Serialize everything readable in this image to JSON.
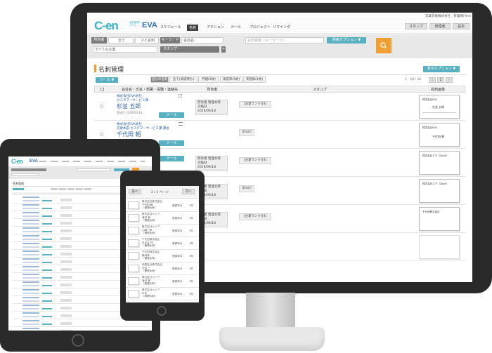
{
  "company": {
    "name": "営業支援株式会社",
    "user": "管理者(Yev)"
  },
  "app": {
    "logo_main": "C-en",
    "logo_sub": "名刺管理システム",
    "logo_eva": "EVA"
  },
  "nav": [
    "スケジュール",
    "名刺",
    "アクション",
    "メール",
    "プロジェクト",
    "リマインダ"
  ],
  "header_buttons": {
    "stamp": "スタンプ",
    "admin": "管理者",
    "settings": "設定"
  },
  "filters": {
    "owner_label": "所有者",
    "owner_value": "全て",
    "my_label": "マイ名刺",
    "keyword_label": "キーワード",
    "keyword_value": "会社名",
    "company_value": "すべての企業",
    "stamp_value": "スタンプ",
    "search_placeholder": "名刺検索（キーワード）",
    "search_option": "検索オプション ▼",
    "search_icon": "search-icon"
  },
  "page": {
    "title": "名刺管理",
    "display_option": "表示オプション ▼",
    "tool_button": "ツール ▼",
    "pagination": "1 - 10 / 10"
  },
  "tabs": [
    "自分の名刺",
    "全て(承認待ち)",
    "代理(5枚)",
    "承認済(5枚)",
    "未登録(1枚)"
  ],
  "table": {
    "headers": [
      "会社名・氏名・部署・役職・連絡先",
      "所有者",
      "スタンプ",
      "名刺画像"
    ],
    "rows": [
      {
        "company": "株式会社EVA会社",
        "dept": "カスタマーサービス課",
        "name": "杉並 五郎",
        "date": "登録日 2019/06/18",
        "mail": "メール",
        "owner": "所有者 管理太郎",
        "reg": "交換日 2019/06/18",
        "stamp": "[注意ランク][4]",
        "card_company": "株式会社EVA",
        "card_name": "杉並 五郎"
      },
      {
        "company": "株式会社EVA会社",
        "dept": "営業本部 カスタマーサービス課 課長",
        "name": "千代田 朝",
        "date": "",
        "mail": "メール",
        "owner": "所有者 管理太郎",
        "reg": "交換日 2019/06/18",
        "stamp": "[Dick]",
        "card_company": "株式会社EVA",
        "card_name": "千代田 朝"
      },
      {
        "company": "",
        "dept": "",
        "name": "",
        "date": "",
        "mail": "メール",
        "owner": "所有者 管理太郎",
        "reg": "交換日 2019/06/18",
        "stamp": "[注意ランク][4]",
        "card_company": "株式会社エデ（Dove）",
        "card_name": ""
      },
      {
        "company": "",
        "dept": "",
        "name": "",
        "date": "",
        "mail": "",
        "owner": "所有者 管理太郎",
        "reg": "交換日 2019/06/18",
        "stamp": "[Dick]",
        "card_company": "株式会社エデ（Dove）",
        "card_name": ""
      },
      {
        "company": "",
        "dept": "",
        "name": "",
        "date": "",
        "mail": "",
        "owner": "所有者 管理太郎",
        "reg": "交換日 2019/06/18",
        "stamp": "[注意ランク][4]",
        "card_company": "千代田株式会社",
        "card_name": ""
      }
    ]
  },
  "phone": {
    "prev": "前へ",
    "page": "2 / 3 ページ",
    "next": "次へ",
    "items": [
      {
        "company": "株式会社株式会社",
        "name": "千代田 朝",
        "owner": "（管理太郎）",
        "status": "登録済み",
        "count": "1件"
      },
      {
        "company": "株式会社カイア",
        "name": "滝沢 紫",
        "owner": "（管理太郎）",
        "status": "登録済み",
        "count": "1件"
      },
      {
        "company": "株式会社カイア",
        "name": "山崎一郎",
        "owner": "（管理太郎）",
        "status": "登録済み",
        "count": "1件"
      },
      {
        "company": "千代田株式会社",
        "name": "日比谷 林",
        "owner": "（管理太郎）",
        "status": "登録済み",
        "count": "1件"
      },
      {
        "company": "千代田株式会社",
        "name": "築地林",
        "owner": "（管理太郎）",
        "status": "登録済み",
        "count": "1件"
      },
      {
        "company": "和泉会社株式会社",
        "name": "渋谷 ー",
        "owner": "（管理太郎）",
        "status": "登録済み",
        "count": "1件"
      },
      {
        "company": "株式会社カイア",
        "name": "滝沢 紫",
        "owner": "（管理太郎）",
        "status": "登録済み",
        "count": "1件"
      },
      {
        "company": "株式会社カイア",
        "name": "杉本",
        "owner": "（管理太郎）",
        "status": "登録済み",
        "count": "1件"
      }
    ]
  },
  "colors": {
    "accent": "#58b0c0",
    "orange": "#f0a033",
    "frame": "#2a2a2a",
    "link": "#2b63b3"
  }
}
